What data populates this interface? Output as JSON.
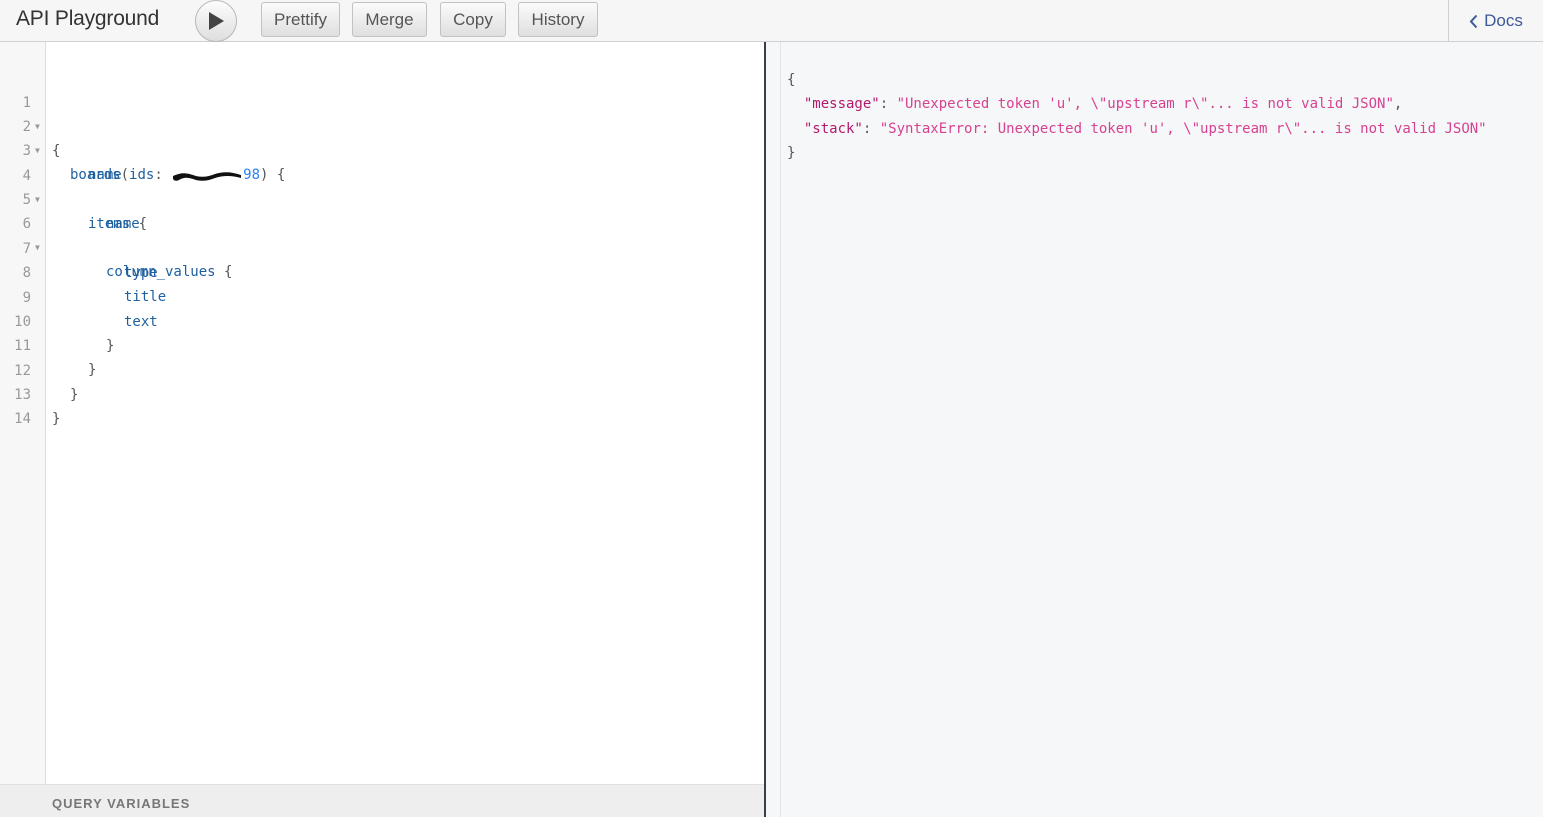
{
  "app": {
    "title": "API Playground"
  },
  "toolbar": {
    "run_label": "",
    "buttons": [
      "Prettify",
      "Merge",
      "Copy",
      "History"
    ],
    "docs_label": "Docs"
  },
  "editor": {
    "line_numbers": [
      "1",
      "2",
      "3",
      "4",
      "5",
      "6",
      "7",
      "8",
      "9",
      "10",
      "11",
      "12",
      "13",
      "14"
    ],
    "lines": {
      "l1": "{",
      "l2_field": "boards",
      "l2_paren": "(",
      "l2_arg": "ids",
      "l2_colon": ": ",
      "l2_val": "98",
      "l2_close": ") {",
      "l3": "name",
      "l4_field": "items",
      "l4_brace": " {",
      "l5": "name",
      "l6_field": "column_values",
      "l6_brace": " {",
      "l7": "type",
      "l8": "title",
      "l9": "text",
      "l10": "}",
      "l11": "}",
      "l12": "}",
      "l13": "}"
    },
    "query_variables_label": "QUERY VARIABLES"
  },
  "result": {
    "open": "{",
    "message_key": "\"message\"",
    "message_value": "\"Unexpected token 'u', \\\"upstream r\\\"... is not valid JSON\"",
    "stack_key": "\"stack\"",
    "stack_value": "\"SyntaxError: Unexpected token 'u', \\\"upstream r\\\"... is not valid JSON\"",
    "close": "}"
  },
  "colors": {
    "accent": "#3b5998",
    "keyword": "#1f61a0",
    "json_key": "#b11a6c",
    "json_string": "#d64292"
  }
}
